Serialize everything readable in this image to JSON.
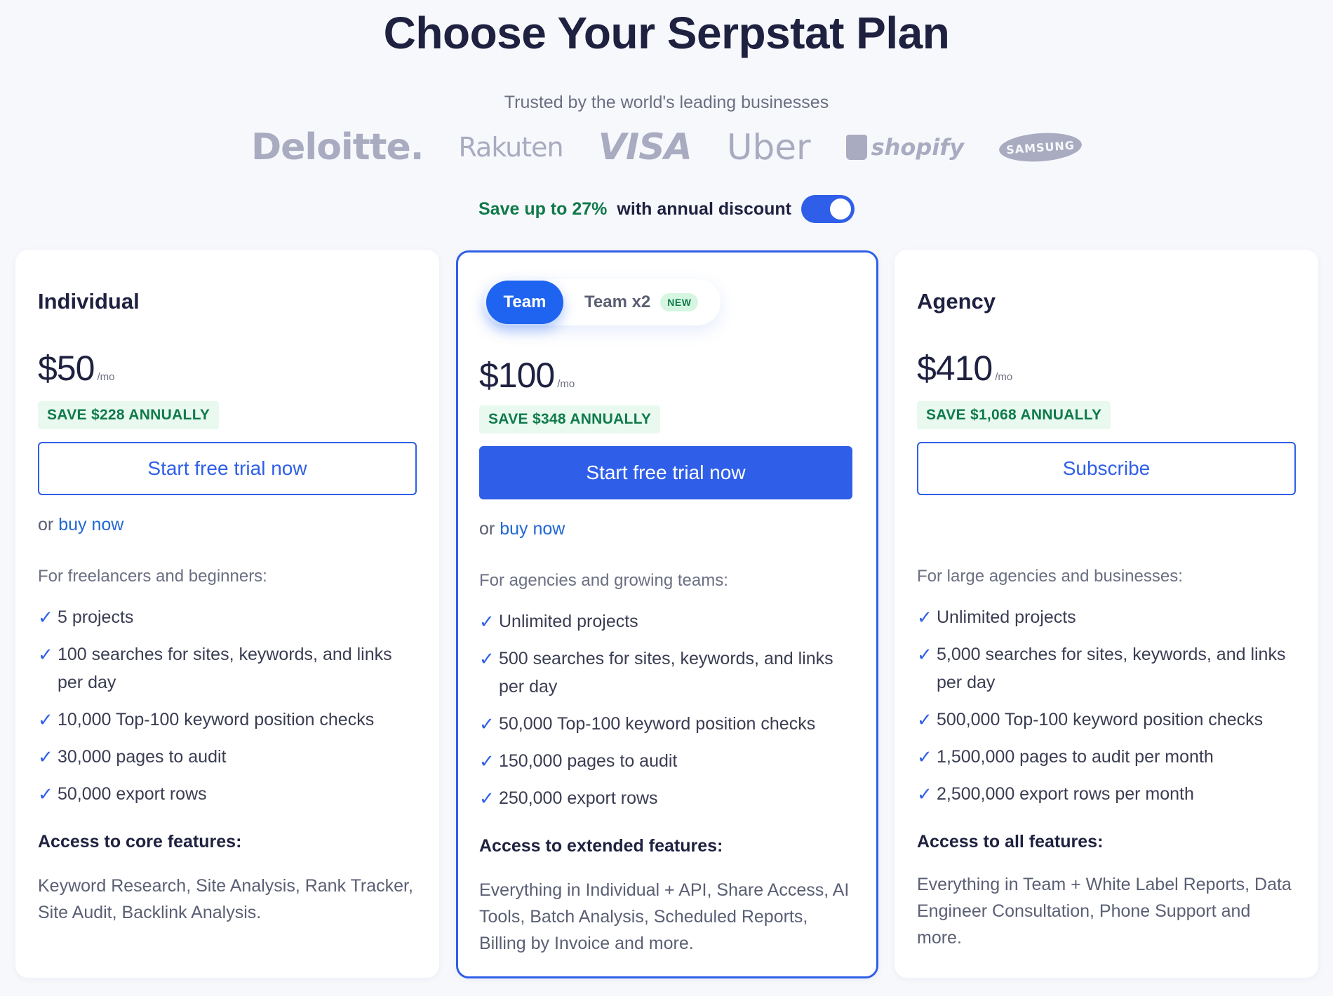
{
  "header": {
    "title": "Choose Your Serpstat Plan",
    "trusted": "Trusted by the world's leading businesses",
    "logos": [
      "Deloitte.",
      "Rakuten",
      "VISA",
      "Uber",
      "shopify",
      "SAMSUNG"
    ]
  },
  "discount": {
    "highlight": "Save up to 27%",
    "rest": "with annual discount",
    "toggle_on": true
  },
  "plans": {
    "individual": {
      "name": "Individual",
      "price": "$50",
      "per": "/mo",
      "save": "SAVE $228 ANNUALLY",
      "button": "Start free trial now",
      "or": "or",
      "buy": "buy now",
      "for": "For freelancers and beginners:",
      "features": [
        "5 projects",
        "100 searches for sites, keywords, and links per day",
        "10,000 Top-100 keyword position checks",
        "30,000 pages to audit",
        "50,000 export rows"
      ],
      "access_title": "Access to core features:",
      "access_text": "Keyword Research, Site Analysis, Rank Tracker, Site Audit, Backlink Analysis."
    },
    "team": {
      "tab_active": "Team",
      "tab_other": "Team x2",
      "new_badge": "NEW",
      "price": "$100",
      "per": "/mo",
      "save": "SAVE $348 ANNUALLY",
      "button": "Start free trial now",
      "or": "or",
      "buy": "buy now",
      "for": "For agencies and growing teams:",
      "features": [
        "Unlimited projects",
        "500 searches for sites, keywords, and links per day",
        "50,000 Top-100 keyword position checks",
        "150,000 pages to audit",
        "250,000 export rows"
      ],
      "access_title": "Access to extended features:",
      "access_text": "Everything in Individual + API, Share Access, AI Tools, Batch Analysis, Scheduled Reports, Billing by Invoice and more."
    },
    "agency": {
      "name": "Agency",
      "price": "$410",
      "per": "/mo",
      "save": "SAVE $1,068 ANNUALLY",
      "button": "Subscribe",
      "for": "For large agencies and businesses:",
      "features": [
        "Unlimited projects",
        "5,000 searches for sites, keywords, and links per day",
        "500,000 Top-100 keyword position checks",
        "1,500,000 pages to audit per month",
        "2,500,000 export rows per month"
      ],
      "access_title": "Access to all features:",
      "access_text": "Everything in Team + White Label Reports, Data Engineer Consultation, Phone Support and more."
    }
  },
  "colors": {
    "accent": "#2f5fe8",
    "save_green": "#0f7a4a",
    "save_bg": "#e9f9ef",
    "logo_gray": "#a9abc0"
  }
}
